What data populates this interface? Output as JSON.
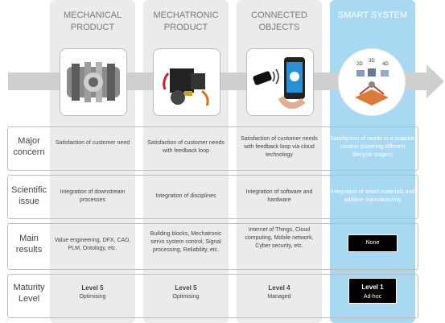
{
  "columns": [
    {
      "title": "MECHANICAL PRODUCT"
    },
    {
      "title": "MECHATRONIC PRODUCT"
    },
    {
      "title": "CONNECTED OBJECTS"
    },
    {
      "title": "SMART SYSTEM"
    }
  ],
  "rows": [
    {
      "label": "Major concern",
      "cells": [
        "Satisfaction of customer need",
        "Satisfaction of customer needs with feedback loop",
        "Satisfaction of customer needs with feedback loop via cloud technology",
        "Satisfaction of needs in a scalable context (covering different lifecycle stages)"
      ]
    },
    {
      "label": "Scientific issue",
      "cells": [
        "Integration of downstream processes",
        "Integration of disciplines",
        "Integration of software and hardware",
        "Integration of smart materials and additive manufacturing"
      ]
    },
    {
      "label": "Main results",
      "cells": [
        "Value engineering, DFX, CAD, PLM, Ontology, etc.",
        "Building blocks, Mechatronic servo system control, Signal processing, Reliability, etc.",
        "Internet of Things, Cloud computing, Mobile network, Cyber security, etc.",
        "None"
      ]
    },
    {
      "label": "Maturity Level",
      "cells": [
        {
          "level": "Level 5",
          "desc": "Optimising"
        },
        {
          "level": "Level 5",
          "desc": "Optimising"
        },
        {
          "level": "Level 4",
          "desc": "Managed"
        },
        {
          "level": "Level 1",
          "desc": "Ad-hoc"
        }
      ]
    }
  ],
  "smart_image_labels": [
    "2D",
    "3D",
    "4D"
  ],
  "colors": {
    "column_bg": "#ebebeb",
    "smart_bg": "#a9d8f2",
    "arrow": "#cfcfcf",
    "badge": "#000000"
  }
}
